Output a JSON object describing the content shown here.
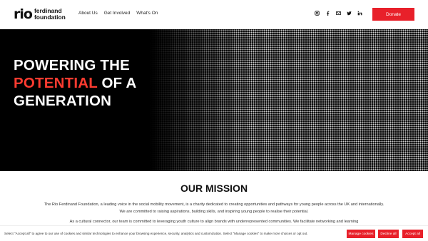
{
  "header": {
    "logo_mark": "rio",
    "logo_line1": "ferdinand",
    "logo_line2": "foundation",
    "nav": [
      "About Us",
      "Get Involved",
      "What's On"
    ],
    "socials": [
      "instagram-icon",
      "facebook-icon",
      "email-icon",
      "twitter-icon",
      "linkedin-icon"
    ],
    "donate_label": "Donate"
  },
  "hero": {
    "line1": "POWERING THE",
    "line2_accent": "POTENTIAL",
    "line2_rest": " OF A",
    "line3": "GENERATION"
  },
  "mission": {
    "title": "OUR MISSION",
    "p1": "The Rio Ferdinand Foundation, a leading voice in the social mobility movement, is a charity dedicated to creating opportunities and pathways for young people across the UK and internationally. We are committed to raising aspirations, building skills, and inspiring young people to realise their potential.",
    "p2": "As a cultural connector, our team is committed to leveraging youth culture to align brands with underrepresented communities. We facilitate networking and learning"
  },
  "cookie": {
    "text": "Select \"Accept all\" to agree to our use of cookies and similar technologies to enhance your browsing experience, security, analytics and customization. Select \"Manage cookies\" to make more choices or opt out.",
    "manage_label": "Manage cookies",
    "decline_label": "Decline all",
    "accept_label": "Accept all"
  },
  "colors": {
    "accent": "#e8202a",
    "hero_bg": "#000000"
  }
}
